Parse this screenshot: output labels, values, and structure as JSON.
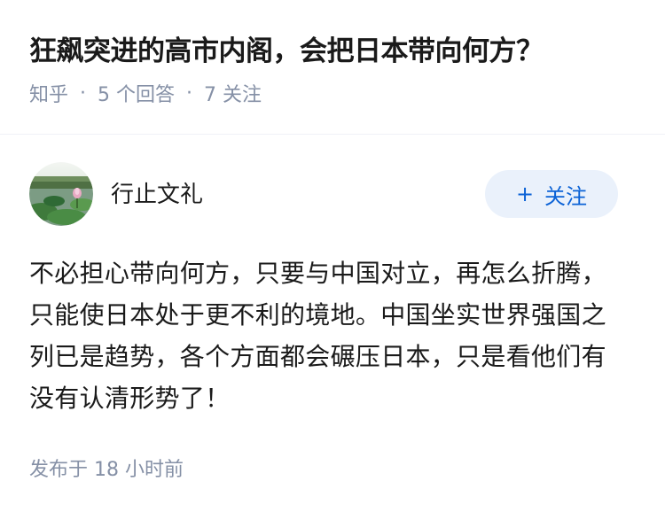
{
  "question": {
    "title": "狂飙突进的高市内阁，会把日本带向何方？",
    "source": "知乎",
    "separator": "·",
    "answer_count": "5 个回答",
    "follow_count": "7 关注"
  },
  "answer": {
    "author_name": "行止文礼",
    "follow_label": "关注",
    "follow_icon": "plus-icon",
    "content": "不必担心带向何方，只要与中国对立，再怎么折腾，只能使日本处于更不利的境地。中国坐实世界强国之列已是趋势，各个方面都会碾压日本，只是看他们有没有认清形势了！",
    "published": "发布于 18 小时前"
  },
  "colors": {
    "accent": "#0b62d6",
    "follow_bg": "#eaf1fb",
    "meta_text": "#8590a6"
  }
}
